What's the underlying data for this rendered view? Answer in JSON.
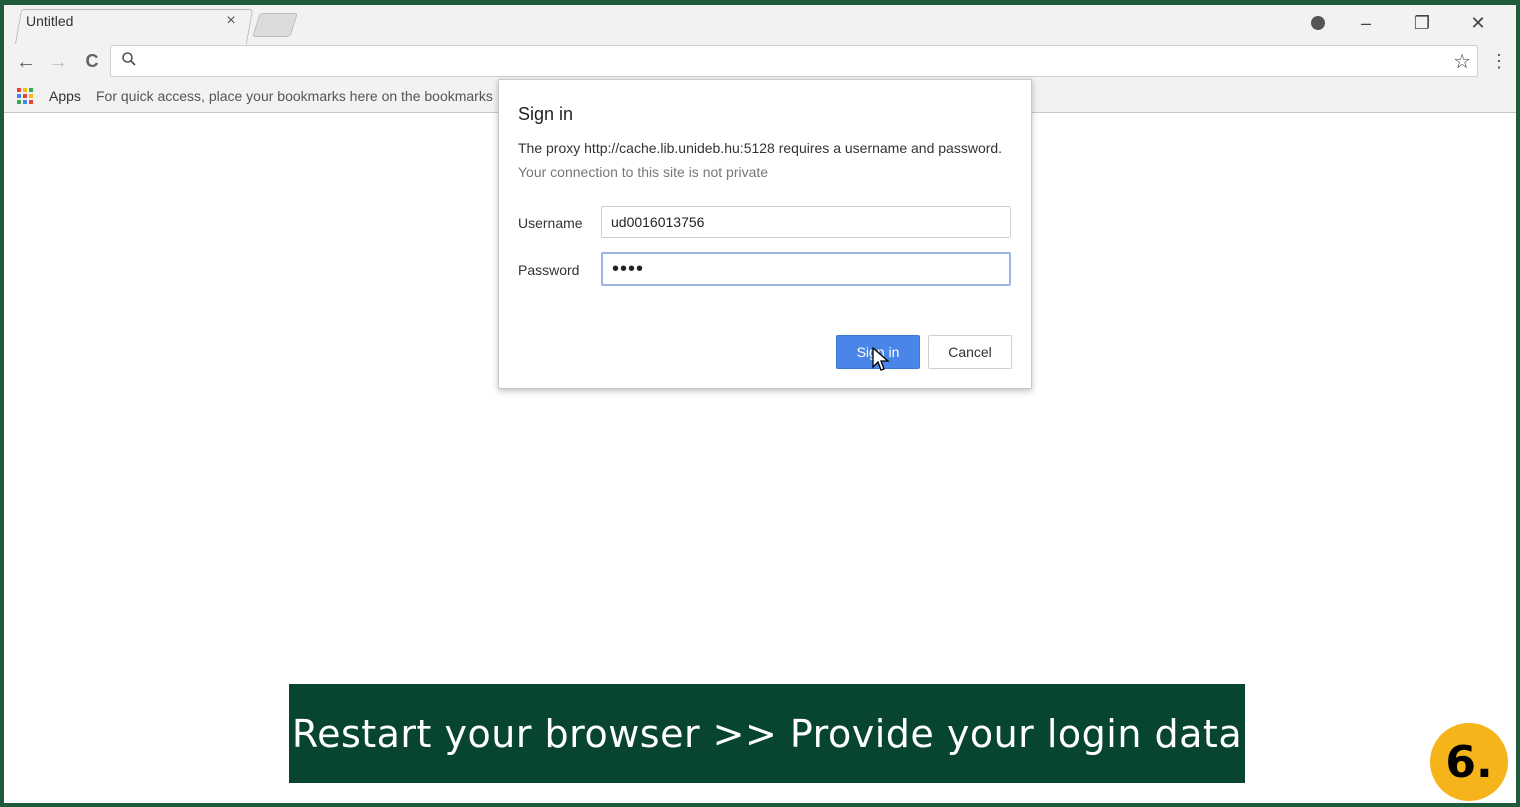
{
  "browser": {
    "tab_title": "Untitled",
    "tab_close": "×",
    "window_controls": {
      "minimize": "–",
      "restore": "❐",
      "close": "✕"
    },
    "nav": {
      "back": "←",
      "forward": "→",
      "reload": "C"
    },
    "omnibox": {
      "value": "",
      "search_icon": "search-icon",
      "star_icon": "star-icon"
    },
    "menu": "⋮",
    "bookmarks": {
      "apps_label": "Apps",
      "hint": "For quick access, place your bookmarks here on the bookmarks"
    }
  },
  "dialog": {
    "title": "Sign in",
    "message": "The proxy http://cache.lib.unideb.hu:5128 requires a username and password.",
    "subtext": "Your connection to this site is not private",
    "username_label": "Username",
    "username_value": "ud0016013756",
    "password_label": "Password",
    "password_value": "••••",
    "signin_label": "Sign in",
    "cancel_label": "Cancel"
  },
  "overlay": {
    "banner_text": "Restart your browser >> Provide your login data",
    "step_label": "6."
  },
  "colors": {
    "frame": "#1d5b3a",
    "banner": "#074531",
    "badge": "#f5b41a",
    "primary_button": "#4a86e8"
  }
}
